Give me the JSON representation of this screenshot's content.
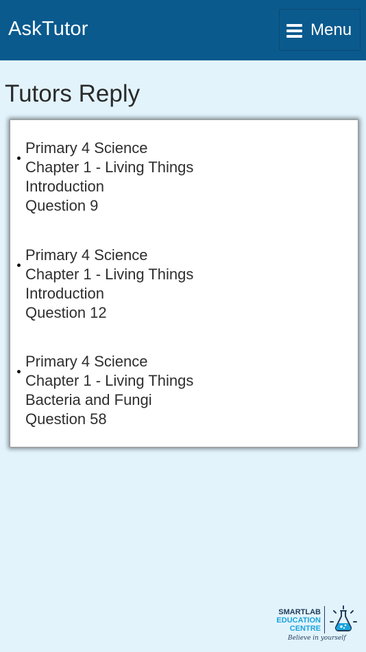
{
  "header": {
    "app_title": "AskTutor",
    "menu_label": "Menu",
    "menu_icon": "hamburger-icon",
    "background_color": "#0a5a8e"
  },
  "page": {
    "title": "Tutors Reply",
    "background_color": "#e2f3fc"
  },
  "replies": [
    {
      "subject": "Primary 4 Science",
      "chapter": "Chapter 1 - Living Things",
      "topic": "Introduction",
      "question": "Question 9"
    },
    {
      "subject": "Primary 4 Science",
      "chapter": "Chapter 1 - Living Things",
      "topic": "Introduction",
      "question": "Question 12"
    },
    {
      "subject": "Primary 4 Science",
      "chapter": "Chapter 1 - Living Things",
      "topic": "Bacteria and Fungi",
      "question": "Question 58"
    }
  ],
  "logo": {
    "line1": "SMARTLAB",
    "line2": "EDUCATION",
    "line3": "CENTRE",
    "tagline": "Believe in yourself",
    "icon": "flask-icon",
    "colors": {
      "dark": "#1f3b5a",
      "accent": "#1aa3dc"
    }
  }
}
